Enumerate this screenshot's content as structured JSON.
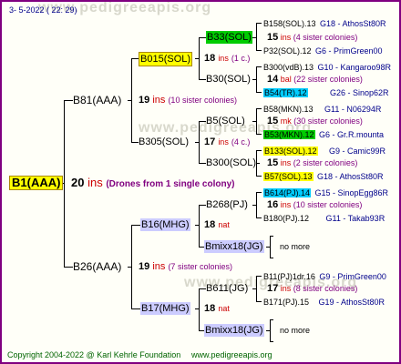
{
  "header_date": "3-  5-2022 ( 22: 29)",
  "watermark": "www.pedigreeapis.org",
  "footer": {
    "copyright": "Copyright 2004-2022 @ Karl Kehrle Foundation",
    "site": "www.pedigreeapis.org"
  },
  "colors": {
    "frame": "#800080",
    "ins_word": "#cc0000",
    "sister_note": "#800080",
    "breeder": "#00008b",
    "highlight_yellow": "#ffff00",
    "highlight_green": "#00cc00",
    "highlight_cyan": "#00ccff",
    "highlight_lavender": "#ccccff"
  },
  "root": {
    "name": "B1(AAA)",
    "ins_count": "20",
    "ins_word": "ins",
    "note": "(Drones from 1 single colony)"
  },
  "gen1": [
    {
      "name": "B81(AAA)",
      "ins_count": "19",
      "ins_word": "ins",
      "note": "(10 sister colonies)"
    },
    {
      "name": "B26(AAA)",
      "ins_count": "19",
      "ins_word": "ins",
      "note": "(7 sister colonies)"
    }
  ],
  "gen2": [
    {
      "name": "B015(SOL)",
      "ins_count": "18",
      "ins_word": "ins",
      "note": "(1 c.)"
    },
    {
      "name": "B305(SOL)",
      "ins_count": "17",
      "ins_word": "ins",
      "note": "(4 c.)"
    },
    {
      "name": "B16(MHG)",
      "ins_count": "18",
      "ins_word": "nat",
      "note": ""
    },
    {
      "name": "B17(MHG)",
      "ins_count": "18",
      "ins_word": "nat",
      "note": ""
    }
  ],
  "gen3": [
    {
      "name": "B33(SOL)",
      "ins_count": "15",
      "ins_word": "ins",
      "note": "(4 sister colonies)"
    },
    {
      "name": "B30(SOL)",
      "ins_count": "14",
      "ins_word": "bal",
      "note": "(22 sister colonies)"
    },
    {
      "name": "B5(SOL)",
      "ins_count": "15",
      "ins_word": "mk",
      "note": "(30 sister colonies)"
    },
    {
      "name": "B300(SOL)",
      "ins_count": "15",
      "ins_word": "ins",
      "note": "(2 sister colonies)"
    },
    {
      "name": "B268(PJ)",
      "ins_count": "16",
      "ins_word": "ins",
      "note": "(10 sister colonies)"
    },
    {
      "name": "Bmixx18(JG)",
      "more": "no more"
    },
    {
      "name": "B611(JG)",
      "ins_count": "17",
      "ins_word": "ins",
      "note": "(8 sister colonies)"
    },
    {
      "name": "Bmixx18(JG)",
      "more": "no more"
    }
  ],
  "gen4": [
    {
      "name": "B158(SOL).13",
      "breeder": "G18 - AthosSt80R"
    },
    {
      "name": "P32(SOL).12",
      "breeder": "G6 - PrimGreen00"
    },
    {
      "name": "B300(vdB).13",
      "breeder": "G10 - Kangaroo98R"
    },
    {
      "name": "B54(TR).12",
      "breeder": "G26 - Sinop62R"
    },
    {
      "name": "B58(MKN).13",
      "breeder": "G11 - N06294R"
    },
    {
      "name": "B53(MKN).12",
      "breeder": "G6 - Gr.R.mounta"
    },
    {
      "name": "B133(SOL).12",
      "breeder": "G9 - Camic99R"
    },
    {
      "name": "B57(SOL).13",
      "breeder": "G18 - AthosSt80R"
    },
    {
      "name": "B614(PJ).14",
      "breeder": "G15 - SinopEgg86R"
    },
    {
      "name": "B180(PJ).12",
      "breeder": "G11 - Takab93R"
    },
    {
      "name": "B11(PJ)1dr.16",
      "breeder": "G9 - PrimGreen00"
    },
    {
      "name": "B171(PJ).15",
      "breeder": "G19 - AthosSt80R"
    }
  ]
}
